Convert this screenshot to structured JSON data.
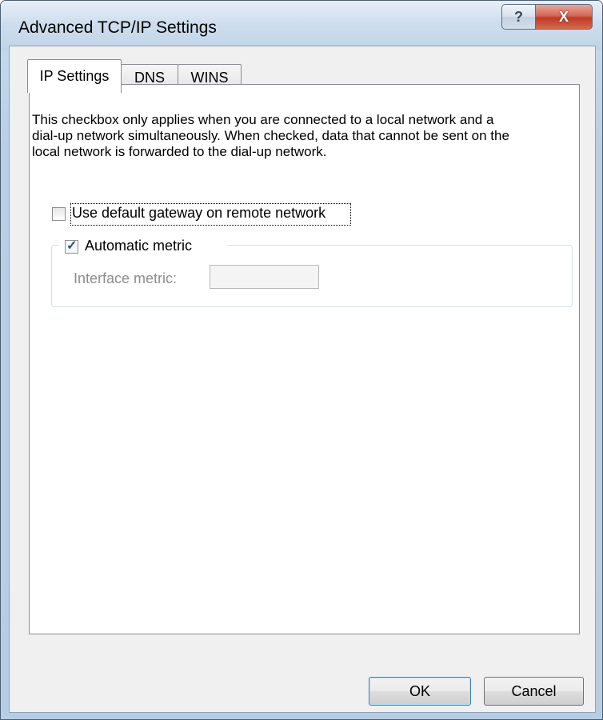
{
  "window": {
    "title": "Advanced TCP/IP Settings",
    "help_glyph": "?",
    "close_glyph": "X"
  },
  "tabs": [
    {
      "label": "IP Settings",
      "active": true
    },
    {
      "label": "DNS",
      "active": false
    },
    {
      "label": "WINS",
      "active": false
    }
  ],
  "panel": {
    "description": "This checkbox only applies when you are connected to a local network and a dial-up network simultaneously.  When checked, data that cannot be sent on the local network is forwarded to the dial-up network.",
    "gateway_checkbox": {
      "label": "Use default gateway on remote network",
      "checked": false
    },
    "metric_checkbox": {
      "label": "Automatic metric",
      "checked": true
    },
    "interface_metric": {
      "label": "Interface metric:",
      "value": "",
      "enabled": false
    }
  },
  "buttons": {
    "ok": "OK",
    "cancel": "Cancel"
  },
  "check_glyph": "✓"
}
